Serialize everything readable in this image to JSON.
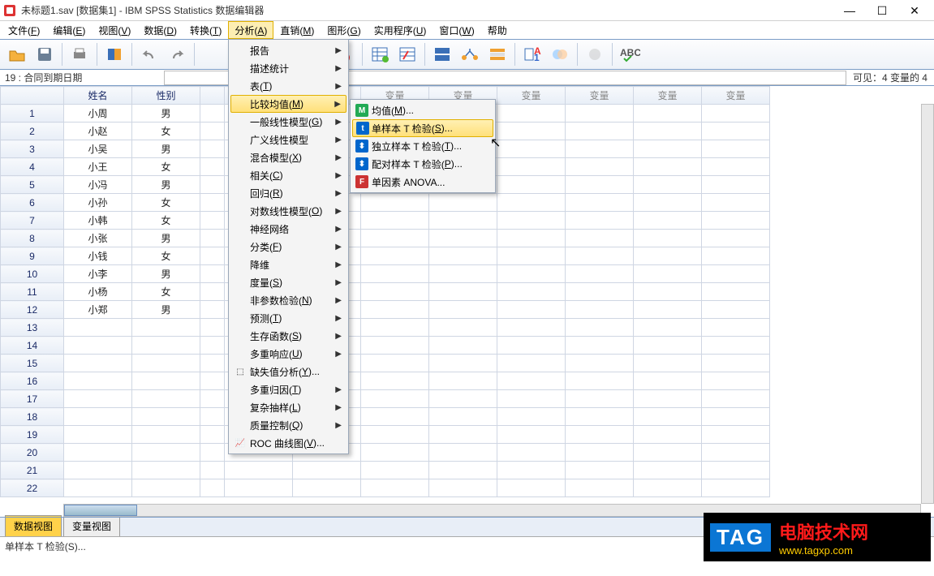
{
  "title": "未标题1.sav [数据集1] - IBM SPSS Statistics 数据编辑器",
  "window_controls": {
    "min": "—",
    "max": "☐",
    "close": "✕"
  },
  "menubar": [
    {
      "label": "文件",
      "key": "F"
    },
    {
      "label": "编辑",
      "key": "E"
    },
    {
      "label": "视图",
      "key": "V"
    },
    {
      "label": "数据",
      "key": "D"
    },
    {
      "label": "转换",
      "key": "T"
    },
    {
      "label": "分析",
      "key": "A",
      "active": true
    },
    {
      "label": "直销",
      "key": "M"
    },
    {
      "label": "图形",
      "key": "G"
    },
    {
      "label": "实用程序",
      "key": "U"
    },
    {
      "label": "窗口",
      "key": "W"
    },
    {
      "label": "帮助",
      "key": ""
    }
  ],
  "info_left": "19 : 合同到期日期",
  "info_right": "可见：4 变量的 4",
  "columns": [
    "姓名",
    "性别",
    "_cut",
    "变量",
    "变量",
    "变量",
    "变量",
    "变量",
    "变量",
    "变量",
    "变量"
  ],
  "rows": [
    {
      "n": "1",
      "name": "小周",
      "sex": "男"
    },
    {
      "n": "2",
      "name": "小赵",
      "sex": "女"
    },
    {
      "n": "3",
      "name": "小吴",
      "sex": "男"
    },
    {
      "n": "4",
      "name": "小王",
      "sex": "女"
    },
    {
      "n": "5",
      "name": "小冯",
      "sex": "男"
    },
    {
      "n": "6",
      "name": "小孙",
      "sex": "女"
    },
    {
      "n": "7",
      "name": "小韩",
      "sex": "女"
    },
    {
      "n": "8",
      "name": "小张",
      "sex": "男"
    },
    {
      "n": "9",
      "name": "小钱",
      "sex": "女"
    },
    {
      "n": "10",
      "name": "小李",
      "sex": "男"
    },
    {
      "n": "11",
      "name": "小杨",
      "sex": "女"
    },
    {
      "n": "12",
      "name": "小郑",
      "sex": "男"
    },
    {
      "n": "13",
      "name": "",
      "sex": ""
    },
    {
      "n": "14",
      "name": "",
      "sex": ""
    },
    {
      "n": "15",
      "name": "",
      "sex": ""
    },
    {
      "n": "16",
      "name": "",
      "sex": ""
    },
    {
      "n": "17",
      "name": "",
      "sex": ""
    },
    {
      "n": "18",
      "name": "",
      "sex": ""
    },
    {
      "n": "19",
      "name": "",
      "sex": ""
    },
    {
      "n": "20",
      "name": "",
      "sex": ""
    },
    {
      "n": "21",
      "name": "",
      "sex": ""
    },
    {
      "n": "22",
      "name": "",
      "sex": ""
    }
  ],
  "analyze_menu": [
    {
      "label": "报告",
      "sub": true
    },
    {
      "label": "描述统计",
      "sub": true
    },
    {
      "label": "表",
      "key": "T",
      "sub": true
    },
    {
      "label": "比较均值",
      "key": "M",
      "sub": true,
      "hl": true
    },
    {
      "label": "一般线性模型",
      "key": "G",
      "sub": true
    },
    {
      "label": "广义线性模型",
      "sub": true
    },
    {
      "label": "混合模型",
      "key": "X",
      "sub": true
    },
    {
      "label": "相关",
      "key": "C",
      "sub": true
    },
    {
      "label": "回归",
      "key": "R",
      "sub": true
    },
    {
      "label": "对数线性模型",
      "key": "O",
      "sub": true
    },
    {
      "label": "神经网络",
      "sub": true
    },
    {
      "label": "分类",
      "key": "F",
      "sub": true
    },
    {
      "label": "降维",
      "sub": true
    },
    {
      "label": "度量",
      "key": "S",
      "sub": true
    },
    {
      "label": "非参数检验",
      "key": "N",
      "sub": true
    },
    {
      "label": "预测",
      "key": "T",
      "sub": true
    },
    {
      "label": "生存函数",
      "key": "S",
      "sub": true
    },
    {
      "label": "多重响应",
      "key": "U",
      "sub": true
    },
    {
      "label": "缺失值分析",
      "key": "Y",
      "suffix": "...",
      "icon": "⬚"
    },
    {
      "label": "多重归因",
      "key": "T",
      "sub": true
    },
    {
      "label": "复杂抽样",
      "key": "L",
      "sub": true
    },
    {
      "label": "质量控制",
      "key": "Q",
      "sub": true
    },
    {
      "label": "ROC 曲线图",
      "key": "V",
      "suffix": "...",
      "icon": "📈"
    }
  ],
  "compare_means_menu": [
    {
      "label": "均值",
      "key": "M",
      "suffix": "...",
      "icon": "M",
      "icolor": "#2a5"
    },
    {
      "label": "单样本 T 检验",
      "key": "S",
      "suffix": "...",
      "hl": true,
      "icon": "t",
      "icolor": "#06c"
    },
    {
      "label": "独立样本 T 检验",
      "key": "T",
      "suffix": "...",
      "icon": "⬍",
      "icolor": "#06c"
    },
    {
      "label": "配对样本 T 检验",
      "key": "P",
      "suffix": "...",
      "icon": "⬍",
      "icolor": "#06c"
    },
    {
      "label": "单因素 ANOVA...",
      "icon": "F",
      "icolor": "#c33"
    }
  ],
  "tabs": {
    "data": "数据视图",
    "var": "变量视图"
  },
  "status": "单样本 T 检验(S)...",
  "watermark": {
    "tag": "TAG",
    "line1": "电脑技术网",
    "line2": "www.tagxp.com"
  }
}
